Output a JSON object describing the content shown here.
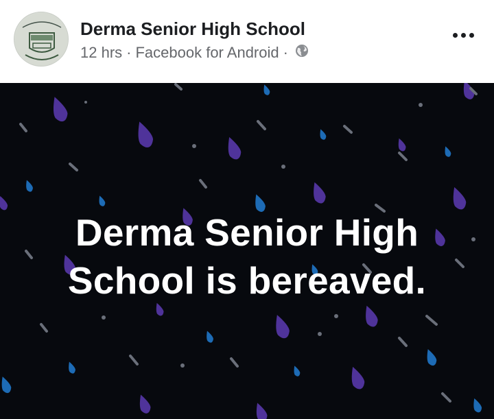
{
  "post": {
    "author": "Derma Senior High School",
    "time": "12 hrs",
    "separator": "·",
    "source": "Facebook for Android",
    "audience_icon": "globe-icon",
    "more_icon": "more-options-icon",
    "avatar": {
      "icon": "school-crest-logo",
      "crest_text": "SHS"
    },
    "text_lines": [
      "Derma Senior High",
      "School is bereaved."
    ]
  },
  "colors": {
    "background": "#07090e",
    "drop_purple": "#5b3aa6",
    "drop_blue": "#1f6fb8",
    "streak_gray": "#6f7480",
    "text": "#ffffff"
  }
}
